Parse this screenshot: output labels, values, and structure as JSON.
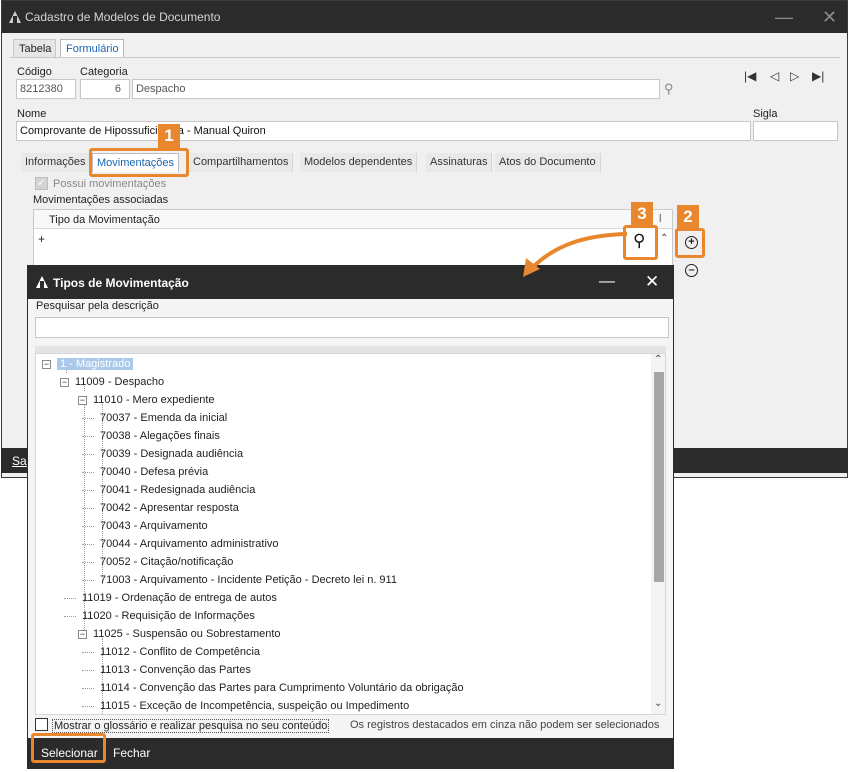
{
  "main": {
    "title": "Cadastro de Modelos de Documento",
    "tabs": [
      "Tabela",
      "Formulário"
    ],
    "codigo_label": "Código",
    "codigo_value": "8212380",
    "categoria_label": "Categoria",
    "categoria_num": "6",
    "categoria_name": "Despacho",
    "nome_label": "Nome",
    "nome_value": "Comprovante de Hipossuficiência - Manual Quiron",
    "sigla_label": "Sigla",
    "sigla_value": "",
    "subtabs": [
      "Informações",
      "Movimentações",
      "Compartilhamentos",
      "Modelos dependentes",
      "Assinaturas",
      "Atos do Documento"
    ],
    "possui_label": "Possui movimentações",
    "associadas_label": "Movimentações associadas",
    "tipo_header": "Tipo da Movimentação",
    "plus_row": "+",
    "bottom_bar_text": "Sal"
  },
  "dialog": {
    "title": "Tipos de Movimentação",
    "search_label": "Pesquisar pela descrição",
    "search_value": "",
    "tree": [
      {
        "text": "1 - Magistrado",
        "level": 0,
        "expandable": true,
        "highlight": true
      },
      {
        "text": "11009 - Despacho",
        "level": 1,
        "expandable": true
      },
      {
        "text": "11010 - Mero expediente",
        "level": 2,
        "expandable": true
      },
      {
        "text": "70037 - Emenda da inicial",
        "level": 3
      },
      {
        "text": "70038 - Alegações finais",
        "level": 3
      },
      {
        "text": "70039 - Designada audiência",
        "level": 3
      },
      {
        "text": "70040 - Defesa prévia",
        "level": 3
      },
      {
        "text": "70041 - Redesignada audiência",
        "level": 3
      },
      {
        "text": "70042 - Apresentar resposta",
        "level": 3
      },
      {
        "text": "70043 - Arquivamento",
        "level": 3
      },
      {
        "text": "70044 - Arquivamento administrativo",
        "level": 3
      },
      {
        "text": "70052 - Citação/notificação",
        "level": 3
      },
      {
        "text": "71003 - Arquivamento - Incidente Petição - Decreto lei n. 911",
        "level": 3
      },
      {
        "text": "11019 - Ordenação de entrega de autos",
        "level": 2
      },
      {
        "text": "11020 - Requisição de Informações",
        "level": 2
      },
      {
        "text": "11025 - Suspensão ou Sobrestamento",
        "level": 2,
        "expandable": true
      },
      {
        "text": "11012 - Conflito de Competência",
        "level": 3
      },
      {
        "text": "11013 - Convenção das Partes",
        "level": 3
      },
      {
        "text": "11014 - Convenção das Partes para Cumprimento Voluntário da obrigação",
        "level": 3
      },
      {
        "text": "11015 - Exceção de Incompetência, suspeição ou Impedimento",
        "level": 3
      }
    ],
    "glossary_label": "Mostrar o glossário e realizar pesquisa no seu conteúdo",
    "grey_note": "Os registros destacados em cinza não podem ser selecionados",
    "select_button": "Selecionar",
    "close_button": "Fechar"
  },
  "callouts": {
    "one": "1",
    "two": "2",
    "three": "3"
  },
  "colors": {
    "accent": "#e8872d",
    "titlebar": "#2b2b2b",
    "link_blue": "#1a66b3",
    "highlight": "#a9c8ea"
  }
}
